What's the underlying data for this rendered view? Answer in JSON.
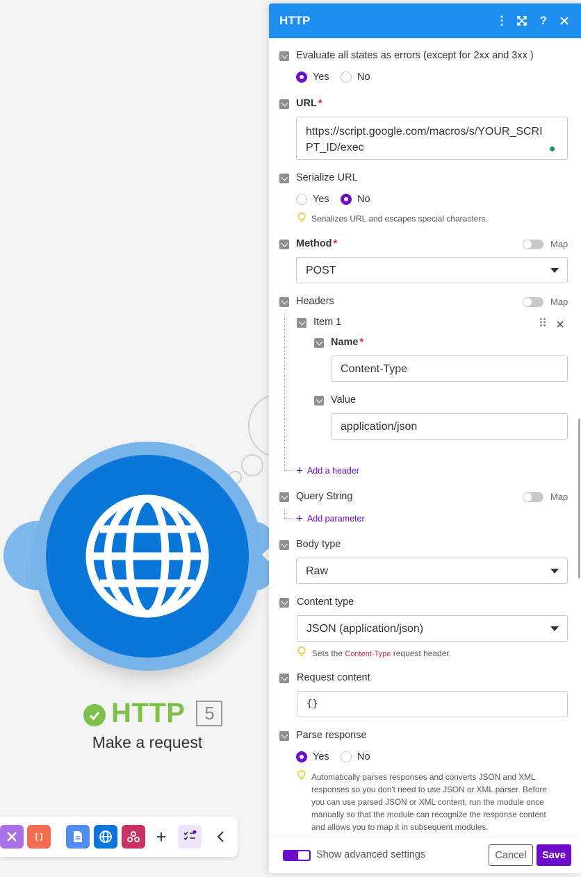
{
  "module": {
    "name": "HTTP",
    "id": "5",
    "subtitle": "Make a request",
    "icon": "globe-icon",
    "ring_color": "#78b4ea",
    "core_color": "#0a76d8",
    "status_color": "#7ec04a"
  },
  "toolbar": {
    "items": [
      "tools-icon",
      "array-icon",
      "document-icon",
      "globe-icon",
      "webhook-icon",
      "plus-icon",
      "checklist-icon",
      "chevron-left-icon"
    ]
  },
  "panel": {
    "title": "HTTP",
    "header_color": "#1e8ef0",
    "accent_color": "#6d0ccc",
    "evaluate_errors": {
      "label": "Evaluate all states as errors (except for 2xx and 3xx )",
      "yes": "Yes",
      "no": "No",
      "selected": "Yes"
    },
    "url": {
      "label": "URL",
      "required": "*",
      "line1": "https://script.google.com/macros/s/YOUR_SCRI",
      "line2": "PT_ID/exec"
    },
    "serialize_url": {
      "label": "Serialize URL",
      "yes": "Yes",
      "no": "No",
      "selected": "No",
      "hint": "Serializes URL and escapes special characters."
    },
    "method": {
      "label": "Method",
      "required": "*",
      "value": "POST",
      "map": "Map",
      "map_enabled": false
    },
    "headers": {
      "label": "Headers",
      "map": "Map",
      "map_enabled": false,
      "item_label": "Item 1",
      "name_label": "Name",
      "name_required": "*",
      "name_value": "Content-Type",
      "value_label": "Value",
      "value_value": "application/json",
      "add": "Add a header"
    },
    "query_string": {
      "label": "Query String",
      "map": "Map",
      "map_enabled": false,
      "add": "Add parameter"
    },
    "body_type": {
      "label": "Body type",
      "value": "Raw"
    },
    "content_type": {
      "label": "Content type",
      "value": "JSON (application/json)",
      "hint_pre": "Sets the",
      "hint_code": "Content-Type",
      "hint_post": "request header."
    },
    "request_content": {
      "label": "Request content",
      "value": "{}"
    },
    "parse_response": {
      "label": "Parse response",
      "yes": "Yes",
      "no": "No",
      "selected": "Yes",
      "hint_lines": [
        "Automatically parses responses and converts JSON and XML",
        "responses so you don't need to use JSON or XML parser. Before",
        "you can use parsed JSON or XML content, run the module once",
        "manually so that the module can recognize the response content",
        "and allows you to map it in subsequent modules."
      ]
    },
    "footer": {
      "advanced_label": "Show advanced settings",
      "advanced_enabled": true,
      "cancel": "Cancel",
      "save": "Save"
    }
  }
}
